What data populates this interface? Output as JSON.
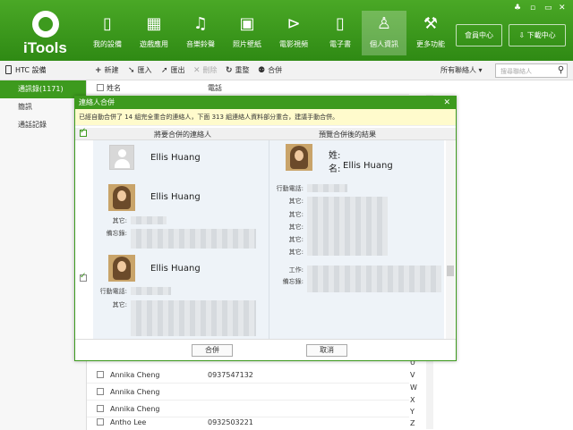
{
  "app": {
    "name": "iTools"
  },
  "nav": [
    {
      "label": "我的設備",
      "icon": "device-icon"
    },
    {
      "label": "遊戲應用",
      "icon": "apps-icon"
    },
    {
      "label": "音樂鈴聲",
      "icon": "music-icon"
    },
    {
      "label": "照片壁紙",
      "icon": "photo-icon"
    },
    {
      "label": "電影視頻",
      "icon": "video-icon"
    },
    {
      "label": "電子書",
      "icon": "book-icon"
    },
    {
      "label": "個人資訊",
      "icon": "person-icon"
    },
    {
      "label": "更多功能",
      "icon": "wrench-icon"
    }
  ],
  "header": {
    "member_center": "會員中心",
    "download_center": "下載中心"
  },
  "toolbar": {
    "device": "HTC 設備",
    "new": "新建",
    "import": "匯入",
    "export": "匯出",
    "delete": "刪除",
    "refresh": "重整",
    "merge": "合併",
    "filter": "所有聯絡人",
    "search_placeholder": "搜尋聯絡人"
  },
  "sidebar": {
    "items": [
      {
        "label": "通訊錄(1171)",
        "active": true
      },
      {
        "label": "簡訊"
      },
      {
        "label": "通話記錄"
      }
    ]
  },
  "list": {
    "col_name": "姓名",
    "col_phone": "電話",
    "rows": [
      {
        "name": "Annika Cheng",
        "phone": "0937547132"
      },
      {
        "name": "Annika Cheng",
        "phone": ""
      },
      {
        "name": "Annika Cheng",
        "phone": ""
      },
      {
        "name": "Antho Lee",
        "phone": "0932503221"
      }
    ],
    "alphabet": [
      "U",
      "V",
      "W",
      "X",
      "Y",
      "Z"
    ]
  },
  "dialog": {
    "title": "連絡人合併",
    "message": "已經自動合併了 14 組完全重合的連絡人，下面 313 組連絡人資料部分重合，建議手動合併。",
    "header_left": "將要合併的連絡人",
    "header_right": "預覽合併後的結果",
    "contacts": [
      {
        "name": "Ellis Huang"
      },
      {
        "name": "Ellis Huang",
        "field_other": "其它:",
        "field_note": "備忘錄:"
      },
      {
        "name": "Ellis Huang",
        "field_mobile": "行動電話:",
        "field_other": "其它:"
      }
    ],
    "preview": {
      "last_name_label": "姓:",
      "first_name_label": "名:",
      "first_name": "Ellis Huang",
      "mobile_label": "行動電話:",
      "other_label": "其它:",
      "work_label": "工作:",
      "note_label": "備忘錄:"
    },
    "merge_button": "合併",
    "cancel_button": "取消"
  }
}
